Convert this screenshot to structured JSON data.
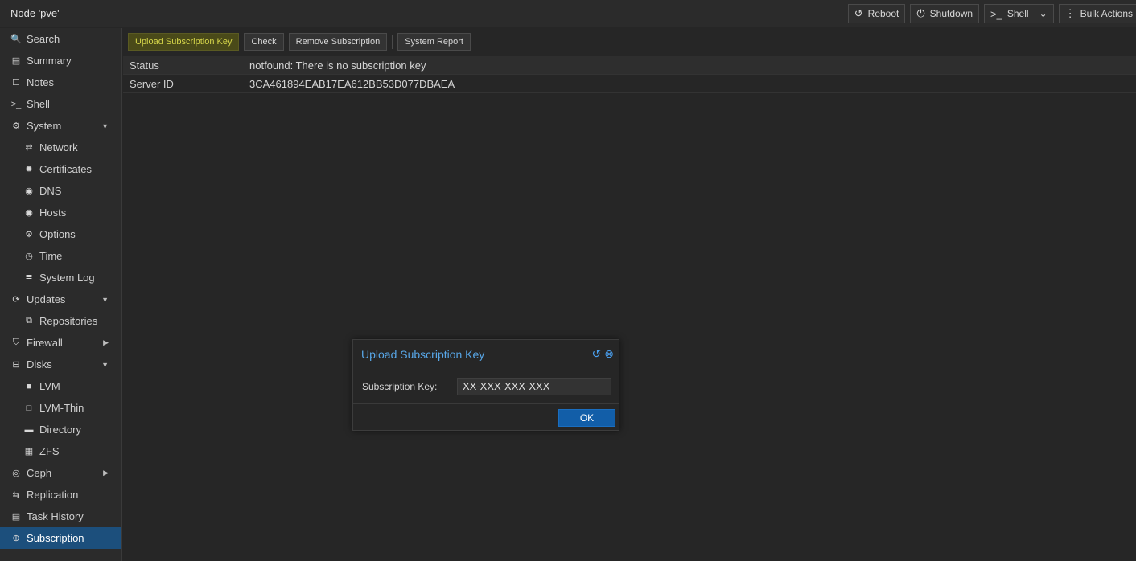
{
  "header": {
    "node_title": "Node 'pve'",
    "actions": [
      {
        "label": "Reboot",
        "icon": "↺"
      },
      {
        "label": "Shutdown",
        "icon": "⏻"
      },
      {
        "label": "Shell",
        "icon": ">_"
      },
      {
        "label": "Bulk Actions",
        "icon": "⋮"
      }
    ]
  },
  "sidebar": {
    "items": [
      {
        "label": "Search",
        "icon": "🔍"
      },
      {
        "label": "Summary",
        "icon": "▤"
      },
      {
        "label": "Notes",
        "icon": "☐"
      },
      {
        "label": "Shell",
        "icon": ">_"
      },
      {
        "label": "System",
        "icon": "⚙"
      },
      {
        "label": "Network",
        "icon": "⇄"
      },
      {
        "label": "Certificates",
        "icon": "✹"
      },
      {
        "label": "DNS",
        "icon": "◉"
      },
      {
        "label": "Hosts",
        "icon": "◉"
      },
      {
        "label": "Options",
        "icon": "⚙"
      },
      {
        "label": "Time",
        "icon": "◷"
      },
      {
        "label": "System Log",
        "icon": "≣"
      },
      {
        "label": "Updates",
        "icon": "⟳"
      },
      {
        "label": "Repositories",
        "icon": "⧉"
      },
      {
        "label": "Firewall",
        "icon": "⛉"
      },
      {
        "label": "Disks",
        "icon": "⊟"
      },
      {
        "label": "LVM",
        "icon": "■"
      },
      {
        "label": "LVM-Thin",
        "icon": "□"
      },
      {
        "label": "Directory",
        "icon": "▬"
      },
      {
        "label": "ZFS",
        "icon": "▦"
      },
      {
        "label": "Ceph",
        "icon": "◎"
      },
      {
        "label": "Replication",
        "icon": "⇆"
      },
      {
        "label": "Task History",
        "icon": "▤"
      },
      {
        "label": "Subscription",
        "icon": "⊕"
      }
    ]
  },
  "toolbar": {
    "upload_label": "Upload Subscription Key",
    "check_label": "Check",
    "remove_label": "Remove Subscription",
    "report_label": "System Report"
  },
  "grid": {
    "rows": [
      {
        "key": "Status",
        "value": "notfound: There is no subscription key"
      },
      {
        "key": "Server ID",
        "value": "3CA461894EAB17EA612BB53D077DBAEA"
      }
    ]
  },
  "dialog": {
    "title": "Upload Subscription Key",
    "field_label": "Subscription Key:",
    "field_value": "XX-XXX-XXX-XXX",
    "ok_label": "OK"
  },
  "colors": {
    "accent": "#58a7e8",
    "selected": "#1c4f7c",
    "highlight_bg": "#4a4a19",
    "highlight_fg": "#d6d64a",
    "ok_button": "#125ea8"
  }
}
